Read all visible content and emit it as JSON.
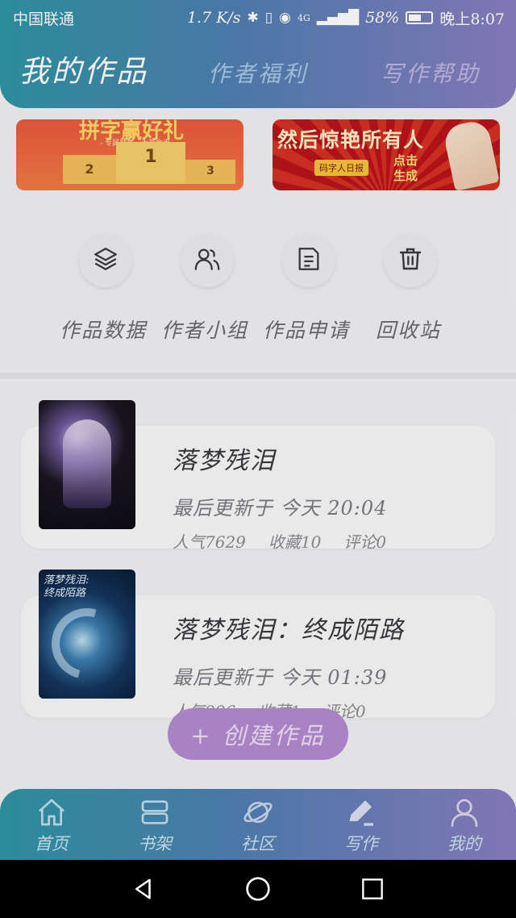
{
  "status_bar": {
    "carrier": "中国联通",
    "speed": "1.7 K/s",
    "network": "4G",
    "battery": "58%",
    "battery_level": 0.58,
    "time": "晚上8:07"
  },
  "header": {
    "active_tab": "我的作品",
    "tabs": [
      "作者福利",
      "写作帮助"
    ]
  },
  "banners": {
    "left": {
      "text": "拼字赢好礼",
      "subtext": "- 专属勋章，大量金币 -",
      "podium": [
        "2",
        "1",
        "3"
      ]
    },
    "right": {
      "text": "然后惊艳所有人",
      "tag": "码字人日报",
      "cta_line1": "点击",
      "cta_line2": "生成"
    }
  },
  "quick_actions": [
    {
      "label": "作品数据",
      "icon": "layers-icon"
    },
    {
      "label": "作者小组",
      "icon": "group-icon"
    },
    {
      "label": "作品申请",
      "icon": "document-icon"
    },
    {
      "label": "回收站",
      "icon": "trash-icon"
    }
  ],
  "works": [
    {
      "title": "落梦残泪",
      "updated": "最后更新于 今天 20:04",
      "popularity": "人气7629",
      "favorites": "收藏10",
      "comments": "评论0"
    },
    {
      "title": "落梦残泪：终成陌路",
      "cover_title_line1": "落梦残泪:",
      "cover_title_line2": "终成陌路",
      "updated": "最后更新于 今天 01:39",
      "popularity": "人气996",
      "favorites": "收藏1",
      "comments": "评论0"
    }
  ],
  "create_button": "+ 创建作品",
  "bottom_nav": [
    {
      "label": "首页",
      "icon": "home-icon"
    },
    {
      "label": "书架",
      "icon": "bookshelf-icon"
    },
    {
      "label": "社区",
      "icon": "planet-icon"
    },
    {
      "label": "写作",
      "icon": "pen-icon"
    },
    {
      "label": "我的",
      "icon": "profile-icon"
    }
  ],
  "colors": {
    "header_gradient_start": "#2f95a4",
    "header_gradient_end": "#8a7ec0",
    "create_button": "#b48bd2"
  }
}
